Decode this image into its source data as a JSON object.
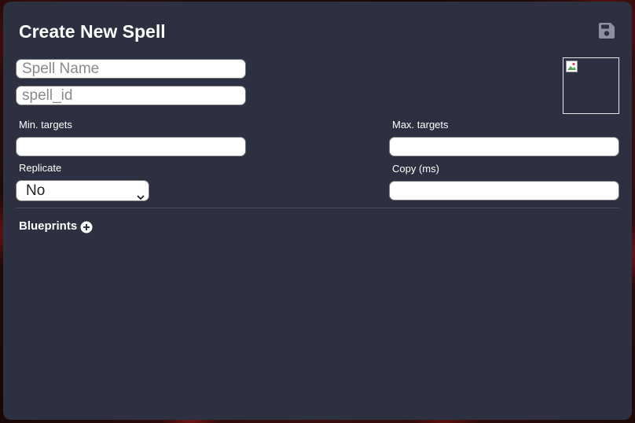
{
  "modal": {
    "title": "Create New Spell",
    "save_icon": "save-icon"
  },
  "fields": {
    "spell_name": {
      "value": "",
      "placeholder": "Spell Name"
    },
    "spell_id": {
      "value": "",
      "placeholder": "spell_id"
    },
    "min_targets": {
      "label": "Min. targets",
      "value": ""
    },
    "max_targets": {
      "label": "Max. targets",
      "value": ""
    },
    "replicate": {
      "label": "Replicate",
      "selected": "No"
    },
    "copy_ms": {
      "label": "Copy (ms)",
      "value": ""
    }
  },
  "image": {
    "icon": "broken-image-icon"
  },
  "blueprints": {
    "title": "Blueprints",
    "add_icon": "plus-circle-icon"
  }
}
